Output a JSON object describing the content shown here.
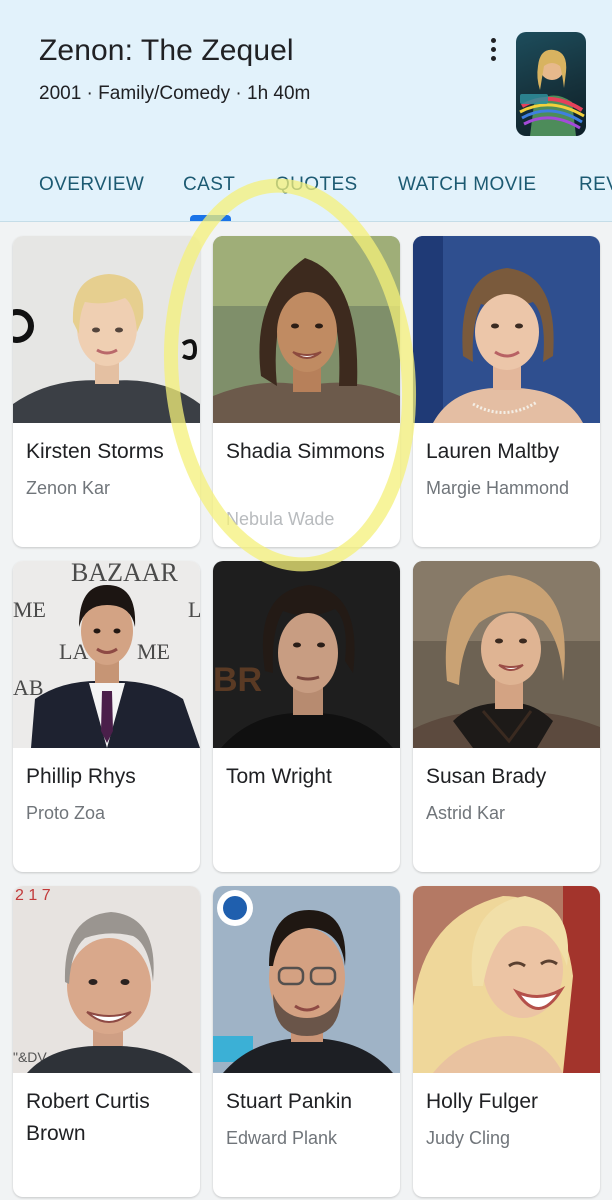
{
  "movie": {
    "title": "Zenon: The Zequel",
    "meta": "2001 · Family/Comedy · 1h 40m"
  },
  "tabs": [
    {
      "label": "OVERVIEW"
    },
    {
      "label": "CAST"
    },
    {
      "label": "QUOTES"
    },
    {
      "label": "WATCH MOVIE"
    },
    {
      "label": "REV"
    }
  ],
  "active_tab": "CAST",
  "cast": [
    {
      "name": "Kirsten Storms",
      "role": "Zenon Kar"
    },
    {
      "name": "Shadia Simmons",
      "role": "Nebula Wade"
    },
    {
      "name": "Lauren Maltby",
      "role": "Margie Hammond"
    },
    {
      "name": "Phillip Rhys",
      "role": "Proto Zoa"
    },
    {
      "name": "Tom Wright",
      "role": ""
    },
    {
      "name": "Susan Brady",
      "role": "Astrid Kar"
    },
    {
      "name": "Robert Curtis Brown",
      "role": ""
    },
    {
      "name": "Stuart Pankin",
      "role": "Edward Plank"
    },
    {
      "name": "Holly Fulger",
      "role": "Judy Cling"
    }
  ],
  "colors": {
    "header_bg": "#e2f2fb",
    "tab_text": "#1c5a72",
    "tab_indicator": "#1a73e8",
    "highlight": "#f4f07a"
  }
}
